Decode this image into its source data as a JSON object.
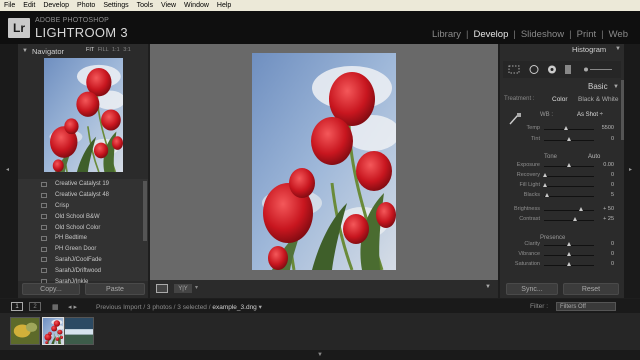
{
  "menu": [
    "File",
    "Edit",
    "Develop",
    "Photo",
    "Settings",
    "Tools",
    "View",
    "Window",
    "Help"
  ],
  "brand": {
    "logo": "Lr",
    "small": "ADOBE PHOTOSHOP",
    "big": "LIGHTROOM 3"
  },
  "modules": {
    "items": [
      "Library",
      "Develop",
      "Slideshow",
      "Print",
      "Web"
    ],
    "active": "Develop"
  },
  "navigator": {
    "title": "Navigator",
    "zoom": {
      "fit": "FIT",
      "fill": "FILL",
      "one": "1:1",
      "ratio": "3:1"
    }
  },
  "presets": [
    "Creative Catalyst 19",
    "Creative Catalyst 48",
    "Crisp",
    "Old School B&W",
    "Old School Color",
    "PH Bedtime",
    "PH Green Door",
    "SarahJ/CoolFade",
    "SarahJ/Driftwood",
    "SarahJ/Inkle"
  ],
  "left_buttons": {
    "copy": "Copy...",
    "paste": "Paste"
  },
  "histogram": {
    "title": "Histogram"
  },
  "basic": {
    "title": "Basic",
    "treatment_label": "Treatment :",
    "treatment_color": "Color",
    "treatment_bw": "Black & White",
    "wb_label": "WB :",
    "wb_value": "As Shot ÷",
    "temp": {
      "label": "Temp",
      "value": "5500",
      "pos": 0.45
    },
    "tint": {
      "label": "Tint",
      "value": "0",
      "pos": 0.5
    },
    "tone_label": "Tone",
    "tone_auto": "Auto",
    "tone": [
      {
        "label": "Exposure",
        "value": "0.00",
        "pos": 0.5
      },
      {
        "label": "Recovery",
        "value": "0",
        "pos": 0.02
      },
      {
        "label": "Fill Light",
        "value": "0",
        "pos": 0.02
      },
      {
        "label": "Blacks",
        "value": "5",
        "pos": 0.06
      }
    ],
    "tone2": [
      {
        "label": "Brightness",
        "value": "+ 50",
        "pos": 0.75
      },
      {
        "label": "Contrast",
        "value": "+ 25",
        "pos": 0.62
      }
    ],
    "presence_label": "Presence",
    "presence": [
      {
        "label": "Clarity",
        "value": "0",
        "pos": 0.5
      },
      {
        "label": "Vibrance",
        "value": "0",
        "pos": 0.5
      },
      {
        "label": "Saturation",
        "value": "0",
        "pos": 0.5
      }
    ]
  },
  "right_buttons": {
    "sync": "Sync...",
    "reset": "Reset"
  },
  "filmstrip": {
    "mon1": "1",
    "mon2": "2",
    "source_prefix": "Previous Import / 3 photos / 3 selected / ",
    "filename": "example_3.dng",
    "filter_label": "Filter :",
    "filter_value": "Filters Off"
  },
  "colors": {
    "bg": "#1e1e1e",
    "panel": "#2b2b2b",
    "center": "#696969",
    "active_text": "#e4e4e4"
  }
}
